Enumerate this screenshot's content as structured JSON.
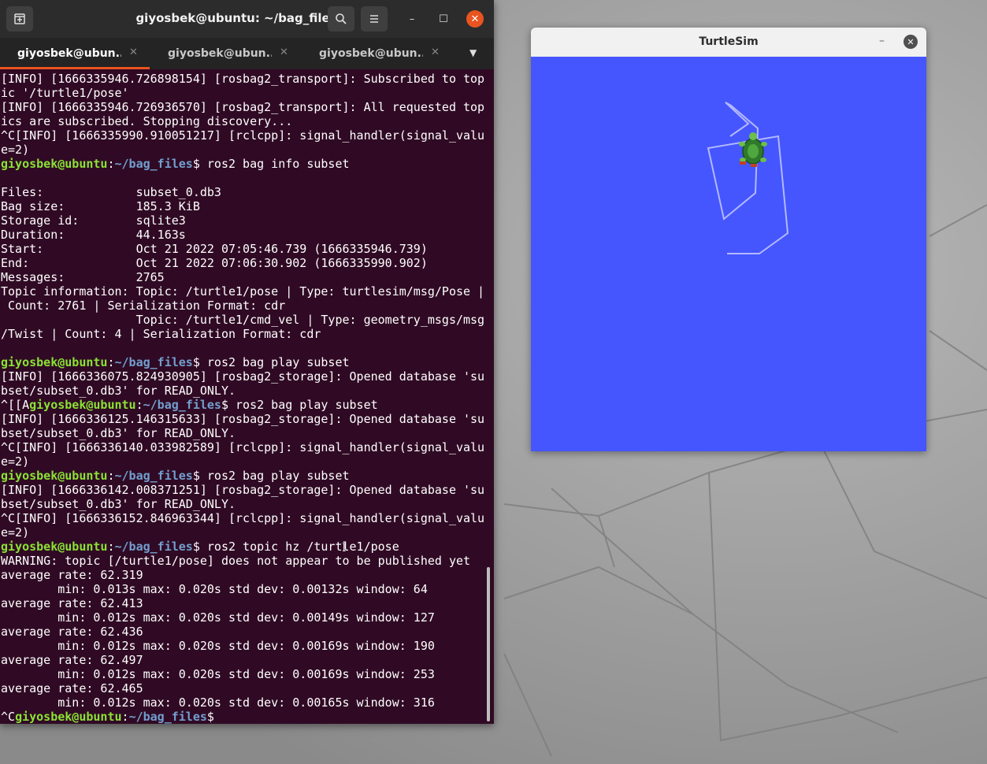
{
  "terminal": {
    "title": "giyosbek@ubuntu: ~/bag_files",
    "header_icons": {
      "new_tab": "new-tab-icon",
      "search": "search-icon",
      "menu": "hamburger-menu-icon"
    },
    "window_controls": {
      "minimize": "–",
      "maximize": "☐",
      "close": "✕"
    },
    "tabs": [
      {
        "label": "giyosbek@ubun...",
        "active": true
      },
      {
        "label": "giyosbek@ubun...",
        "active": false
      },
      {
        "label": "giyosbek@ubun...",
        "active": false
      }
    ],
    "tab_close": "✕",
    "tab_dropdown": "▼",
    "prompt": {
      "user": "giyosbek@ubuntu",
      "path": "~/bag_files"
    },
    "lines": [
      "[INFO] [1666335946.726898154] [rosbag2_transport]: Subscribed to top",
      "ic '/turtle1/pose'",
      "[INFO] [1666335946.726936570] [rosbag2_transport]: All requested top",
      "ics are subscribed. Stopping discovery...",
      "^C[INFO] [1666335990.910051217] [rclcpp]: signal_handler(signal_valu",
      "e=2)",
      "$ ros2 bag info subset",
      "",
      "Files:             subset_0.db3",
      "Bag size:          185.3 KiB",
      "Storage id:        sqlite3",
      "Duration:          44.163s",
      "Start:             Oct 21 2022 07:05:46.739 (1666335946.739)",
      "End:               Oct 21 2022 07:06:30.902 (1666335990.902)",
      "Messages:          2765",
      "Topic information: Topic: /turtle1/pose | Type: turtlesim/msg/Pose |",
      " Count: 2761 | Serialization Format: cdr",
      "                   Topic: /turtle1/cmd_vel | Type: geometry_msgs/msg",
      "/Twist | Count: 4 | Serialization Format: cdr",
      "",
      "$ ros2 bag play subset",
      "[INFO] [1666336075.824930905] [rosbag2_storage]: Opened database 'su",
      "bset/subset_0.db3' for READ_ONLY.",
      "$ ros2 bag play subset",
      "[INFO] [1666336125.146315633] [rosbag2_storage]: Opened database 'su",
      "bset/subset_0.db3' for READ_ONLY.",
      "^C[INFO] [1666336140.033982589] [rclcpp]: signal_handler(signal_valu",
      "e=2)",
      "$ ros2 bag play subset",
      "[INFO] [1666336142.008371251] [rosbag2_storage]: Opened database 'su",
      "bset/subset_0.db3' for READ_ONLY.",
      "^C[INFO] [1666336152.846963344] [rclcpp]: signal_handler(signal_valu",
      "e=2)",
      "$ ros2 topic hz /turtle1/pose",
      "WARNING: topic [/turtle1/pose] does not appear to be published yet",
      "average rate: 62.319",
      "        min: 0.013s max: 0.020s std dev: 0.00132s window: 64",
      "average rate: 62.413",
      "        min: 0.012s max: 0.020s std dev: 0.00149s window: 127",
      "average rate: 62.436",
      "        min: 0.012s max: 0.020s std dev: 0.00169s window: 190",
      "average rate: 62.497",
      "        min: 0.012s max: 0.020s std dev: 0.00169s window: 253",
      "average rate: 62.465",
      "        min: 0.012s max: 0.020s std dev: 0.00165s window: 316",
      "$"
    ],
    "line_prefixes": {
      "23": "^[[A",
      "45": "^C"
    },
    "prompt_lines": [
      6,
      20,
      23,
      28,
      33,
      45
    ]
  },
  "turtlesim": {
    "title": "TurtleSim",
    "minimize": "–",
    "close": "✕",
    "background_color": "#4556ff",
    "pen_color": "#b3b8ff",
    "turtle_icon": "turtle-icon"
  }
}
